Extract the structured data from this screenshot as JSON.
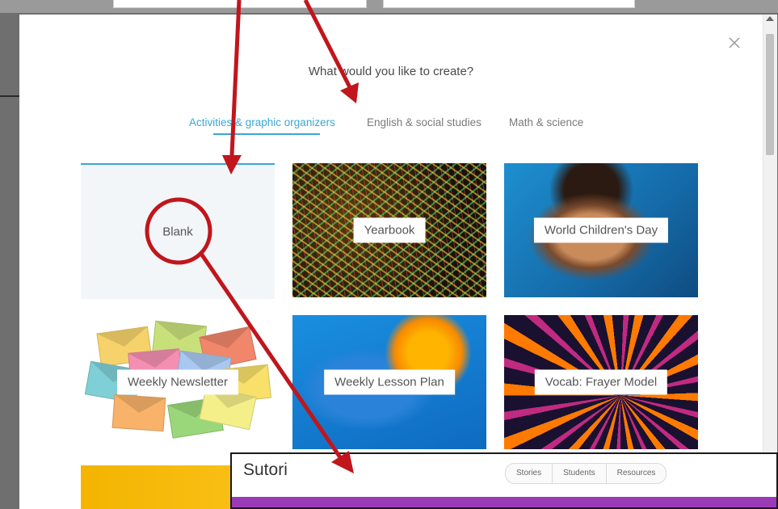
{
  "modal": {
    "title": "What would you like to create?",
    "close_icon": "close-icon",
    "tabs": [
      {
        "label": "Activities & graphic organizers",
        "active": true
      },
      {
        "label": "English & social studies",
        "active": false
      },
      {
        "label": "Math & science",
        "active": false
      }
    ],
    "templates": [
      {
        "label": "Blank"
      },
      {
        "label": "Yearbook"
      },
      {
        "label": "World Children's Day"
      },
      {
        "label": "Weekly Newsletter"
      },
      {
        "label": "Weekly Lesson Plan"
      },
      {
        "label": "Vocab: Frayer Model"
      }
    ],
    "accent_color": "#3aa7d6"
  },
  "sutori": {
    "logo": "Sutori",
    "nav": [
      "Stories",
      "Students",
      "Resources"
    ],
    "brand_color": "#9b3ab7"
  },
  "annotation_color": "#c0161c"
}
